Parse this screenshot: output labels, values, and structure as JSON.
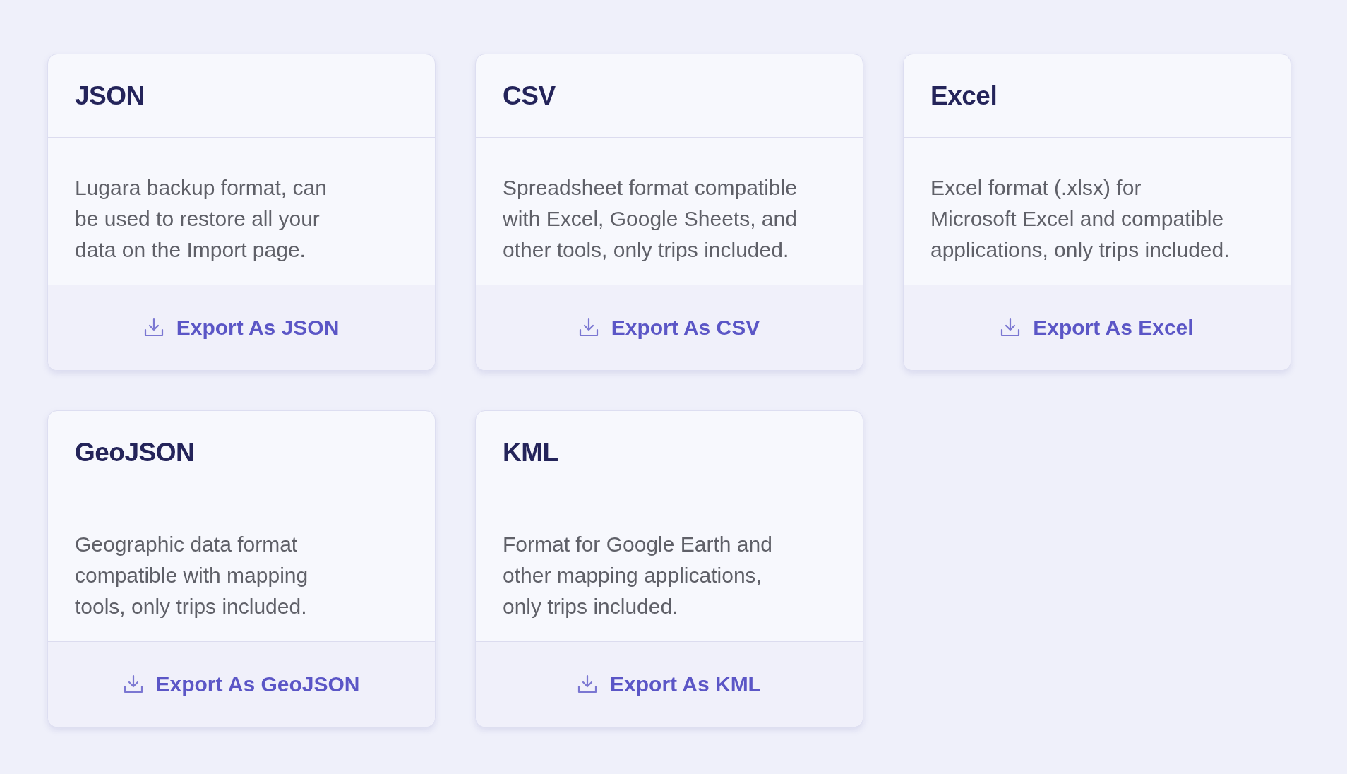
{
  "cards": [
    {
      "title": "JSON",
      "description": "Lugara backup format, can be used to restore all your data on the Import page.",
      "button": "Export As JSON"
    },
    {
      "title": "CSV",
      "description": "Spreadsheet format compatible with Excel, Google Sheets, and other tools, only trips included.",
      "button": "Export As CSV"
    },
    {
      "title": "Excel",
      "description": "Excel format (.xlsx) for Microsoft Excel and compatible applications, only trips included.",
      "button": "Export As Excel"
    },
    {
      "title": "GeoJSON",
      "description": "Geographic data format compatible with mapping tools, only trips included.",
      "button": "Export As GeoJSON"
    },
    {
      "title": "KML",
      "description": "Format for Google Earth and other mapping applications, only trips included.",
      "button": "Export As KML"
    }
  ]
}
